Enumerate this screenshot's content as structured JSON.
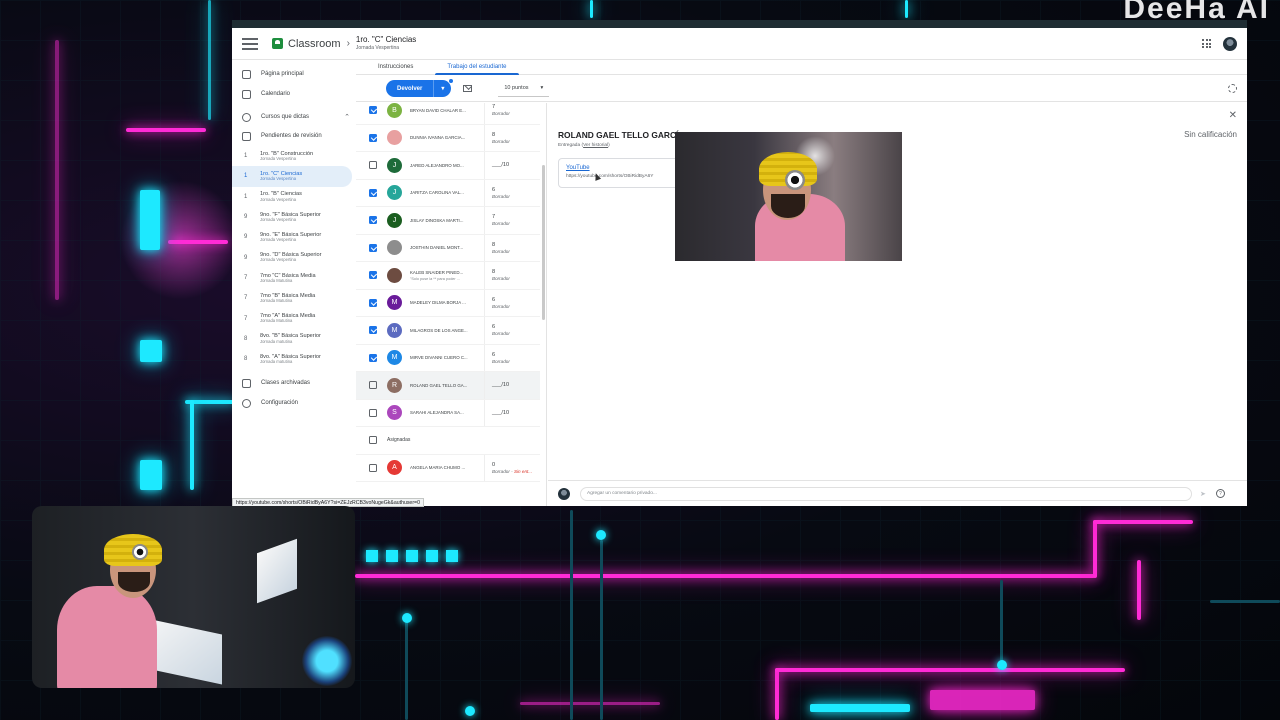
{
  "app": {
    "name": "Classroom",
    "course_title": "1ro. \"C\" Ciencias",
    "course_subtitle": "Jornada Vespertina",
    "overlay_brand": "DeeHa AI"
  },
  "sidebar": {
    "home": "Página principal",
    "calendar": "Calendario",
    "teaching_section": "Cursos que dictas",
    "pending": "Pendientes de revisión",
    "courses": [
      {
        "num": "1",
        "name": "1ro. \"B\" Construcción",
        "shift": "Jornada Vespertina",
        "active": false
      },
      {
        "num": "1",
        "name": "1ro. \"C\" Ciencias",
        "shift": "Jornada Vespertina",
        "active": true
      },
      {
        "num": "1",
        "name": "1ro. \"B\" Ciencias",
        "shift": "Jornada Vespertina",
        "active": false
      },
      {
        "num": "9",
        "name": "9no. \"F\" Básica Superior",
        "shift": "Jornada Vespertina",
        "active": false
      },
      {
        "num": "9",
        "name": "9no. \"E\" Básica Superior",
        "shift": "Jornada Vespertina",
        "active": false
      },
      {
        "num": "9",
        "name": "9no. \"D\" Básica Superior",
        "shift": "Jornada Vespertina",
        "active": false
      },
      {
        "num": "7",
        "name": "7mo \"C\" Básica Media",
        "shift": "Jornada Matutina",
        "active": false
      },
      {
        "num": "7",
        "name": "7mo \"B\" Básica Media",
        "shift": "Jornada Matutina",
        "active": false
      },
      {
        "num": "7",
        "name": "7mo \"A\" Básica Media",
        "shift": "Jornada Matutina",
        "active": false
      },
      {
        "num": "8",
        "name": "8vo. \"B\" Básica Superior",
        "shift": "Jornada matutina",
        "active": false
      },
      {
        "num": "8",
        "name": "8vo. \"A\" Básica Superior",
        "shift": "Jornada matutina",
        "active": false
      }
    ],
    "archived": "Clases archivadas",
    "settings": "Configuración"
  },
  "tabs": [
    {
      "label": "Instrucciones",
      "active": false
    },
    {
      "label": "Trabajo del estudiante",
      "active": true
    }
  ],
  "toolbar": {
    "return_label": "Devolver",
    "points_label": "10 puntos"
  },
  "students": [
    {
      "name": "BRYAN DAVID CHALAR E...",
      "sub": "",
      "initial": "B",
      "color": "#7cb342",
      "checked": true,
      "grade": "7",
      "status": "Borrador"
    },
    {
      "name": "DUNNIA IVANNA GARCIA...",
      "sub": "",
      "initial": "",
      "color": "#e8a0a0",
      "checked": true,
      "grade": "8",
      "status": "Borrador"
    },
    {
      "name": "JARED ALEJANDRO MO...",
      "sub": "",
      "initial": "J",
      "color": "#1e6b3a",
      "checked": false,
      "grade": "___/10",
      "status": ""
    },
    {
      "name": "JARITZA CAROLINA VAL...",
      "sub": "",
      "initial": "J",
      "color": "#26a69a",
      "checked": true,
      "grade": "6",
      "status": "Borrador"
    },
    {
      "name": "JISLAY DINOSKA MARTI...",
      "sub": "",
      "initial": "J",
      "color": "#1b5e20",
      "checked": true,
      "grade": "7",
      "status": "Borrador"
    },
    {
      "name": "JOSTHIN DANIEL MONT...",
      "sub": "",
      "initial": "",
      "color": "#8d8d8d",
      "checked": true,
      "grade": "8",
      "status": "Borrador"
    },
    {
      "name": "KALEB SNAIDER PINED...",
      "sub": "\"Solo puse la ** para poder ...",
      "initial": "",
      "color": "#6d4c41",
      "checked": true,
      "grade": "8",
      "status": "Borrador"
    },
    {
      "name": "MADELEY DILMA BORJA ...",
      "sub": "",
      "initial": "M",
      "color": "#6a1b9a",
      "checked": true,
      "grade": "6",
      "status": "Borrador"
    },
    {
      "name": "MILAGROS DE LOS ANGE...",
      "sub": "",
      "initial": "M",
      "color": "#5c6bc0",
      "checked": true,
      "grade": "6",
      "status": "Borrador"
    },
    {
      "name": "MIRVE DIVANNI CUERO C...",
      "sub": "",
      "initial": "M",
      "color": "#1e88e5",
      "checked": true,
      "grade": "6",
      "status": "Borrador"
    },
    {
      "name": "ROLAND GAEL TELLO GA...",
      "sub": "",
      "initial": "R",
      "color": "#8d6e63",
      "checked": false,
      "grade": "___/10",
      "status": "",
      "selected": true
    },
    {
      "name": "SARAHI ALEJANDRA SA...",
      "sub": "",
      "initial": "S",
      "color": "#ab47bc",
      "checked": false,
      "grade": "___/10",
      "status": ""
    }
  ],
  "assigned_section": "Asignadas",
  "assigned_students": [
    {
      "name": "ANGELA MARIA CHUMO ...",
      "initial": "A",
      "color": "#e53935",
      "checked": false,
      "grade": "0",
      "status": "Borrador",
      "status_extra": "Sin ent..."
    }
  ],
  "detail": {
    "student_name": "ROLAND GAEL TELLO GARCÍA",
    "status": "Entregada",
    "history_link": "Ver historial",
    "grade_status": "Sin calificación",
    "attachment_title": "YouTube",
    "attachment_url": "https://youtube.com/shorts/OBiRidByA6Y",
    "comment_placeholder": "Agregar un comentario privado..."
  },
  "status_bar_url": "https://youtube.com/shorts/OBiRidByA6Y?si=ZEJzRCB3voNugeGk&authuser=0",
  "icons": [
    "menu-icon",
    "apps-icon",
    "mail-icon",
    "gear-icon",
    "close-icon",
    "send-icon",
    "help-icon",
    "home-icon",
    "calendar-icon",
    "people-icon",
    "archive-icon",
    "settings-icon"
  ]
}
